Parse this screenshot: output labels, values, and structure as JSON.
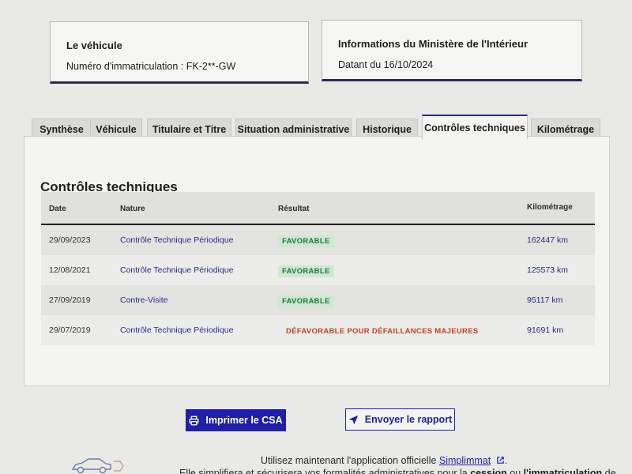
{
  "vehicle_box": {
    "title": "Le véhicule",
    "immat_label": "Numéro d'immatriculation : FK-2**-GW"
  },
  "ministere_box": {
    "title": "Informations du Ministère de l'Intérieur",
    "date_text": "Datant du 16/10/2024"
  },
  "tabs": [
    {
      "label": "Synthèse"
    },
    {
      "label": "Véhicule"
    },
    {
      "label": "Titulaire et Titre"
    },
    {
      "label": "Situation administrative"
    },
    {
      "label": "Historique"
    },
    {
      "label": "Contrôles techniques",
      "active": true
    },
    {
      "label": "Kilométrage"
    }
  ],
  "section": {
    "title": "Contrôles techniques",
    "columns": [
      "Date",
      "Nature",
      "Résultat",
      "Kilométrage"
    ],
    "rows": [
      {
        "date": "29/09/2023",
        "nature": "Contrôle Technique Périodique",
        "result": "FAVORABLE",
        "status": "ok",
        "km": "162447 km"
      },
      {
        "date": "12/08/2021",
        "nature": "Contrôle Technique Périodique",
        "result": "FAVORABLE",
        "status": "ok",
        "km": "125573 km"
      },
      {
        "date": "27/09/2019",
        "nature": "Contre-Visite",
        "result": "FAVORABLE",
        "status": "ok",
        "km": "95117 km"
      },
      {
        "date": "29/07/2019",
        "nature": "Contrôle Technique Périodique",
        "result": "DÉFAVORABLE POUR DÉFAILLANCES MAJEURES",
        "status": "ko",
        "km": "91691 km"
      }
    ]
  },
  "actions": {
    "print_label": "Imprimer le CSA",
    "send_label": "Envoyer le rapport"
  },
  "footer": {
    "line1_prefix": "Utilisez maintenant l'application officielle",
    "line1_link": "Simplimmat",
    "line1_suffix": ".",
    "line2_prefix": "Elle simplifiera et sécurisera vos formalités administratives pour la",
    "line2_bold1": "cession",
    "line2_mid": "ou",
    "line2_bold2": "l'immatriculation",
    "line2_suffix": "de"
  },
  "icons": {
    "print": "printer-icon",
    "send": "paper-plane-icon",
    "external": "external-link-icon",
    "car": "car-icon"
  },
  "colors": {
    "accent": "#1f1fa8",
    "ok_bg": "#cfe7d3",
    "ok_text": "#1f7a3a",
    "ko_text": "#c0441d"
  }
}
